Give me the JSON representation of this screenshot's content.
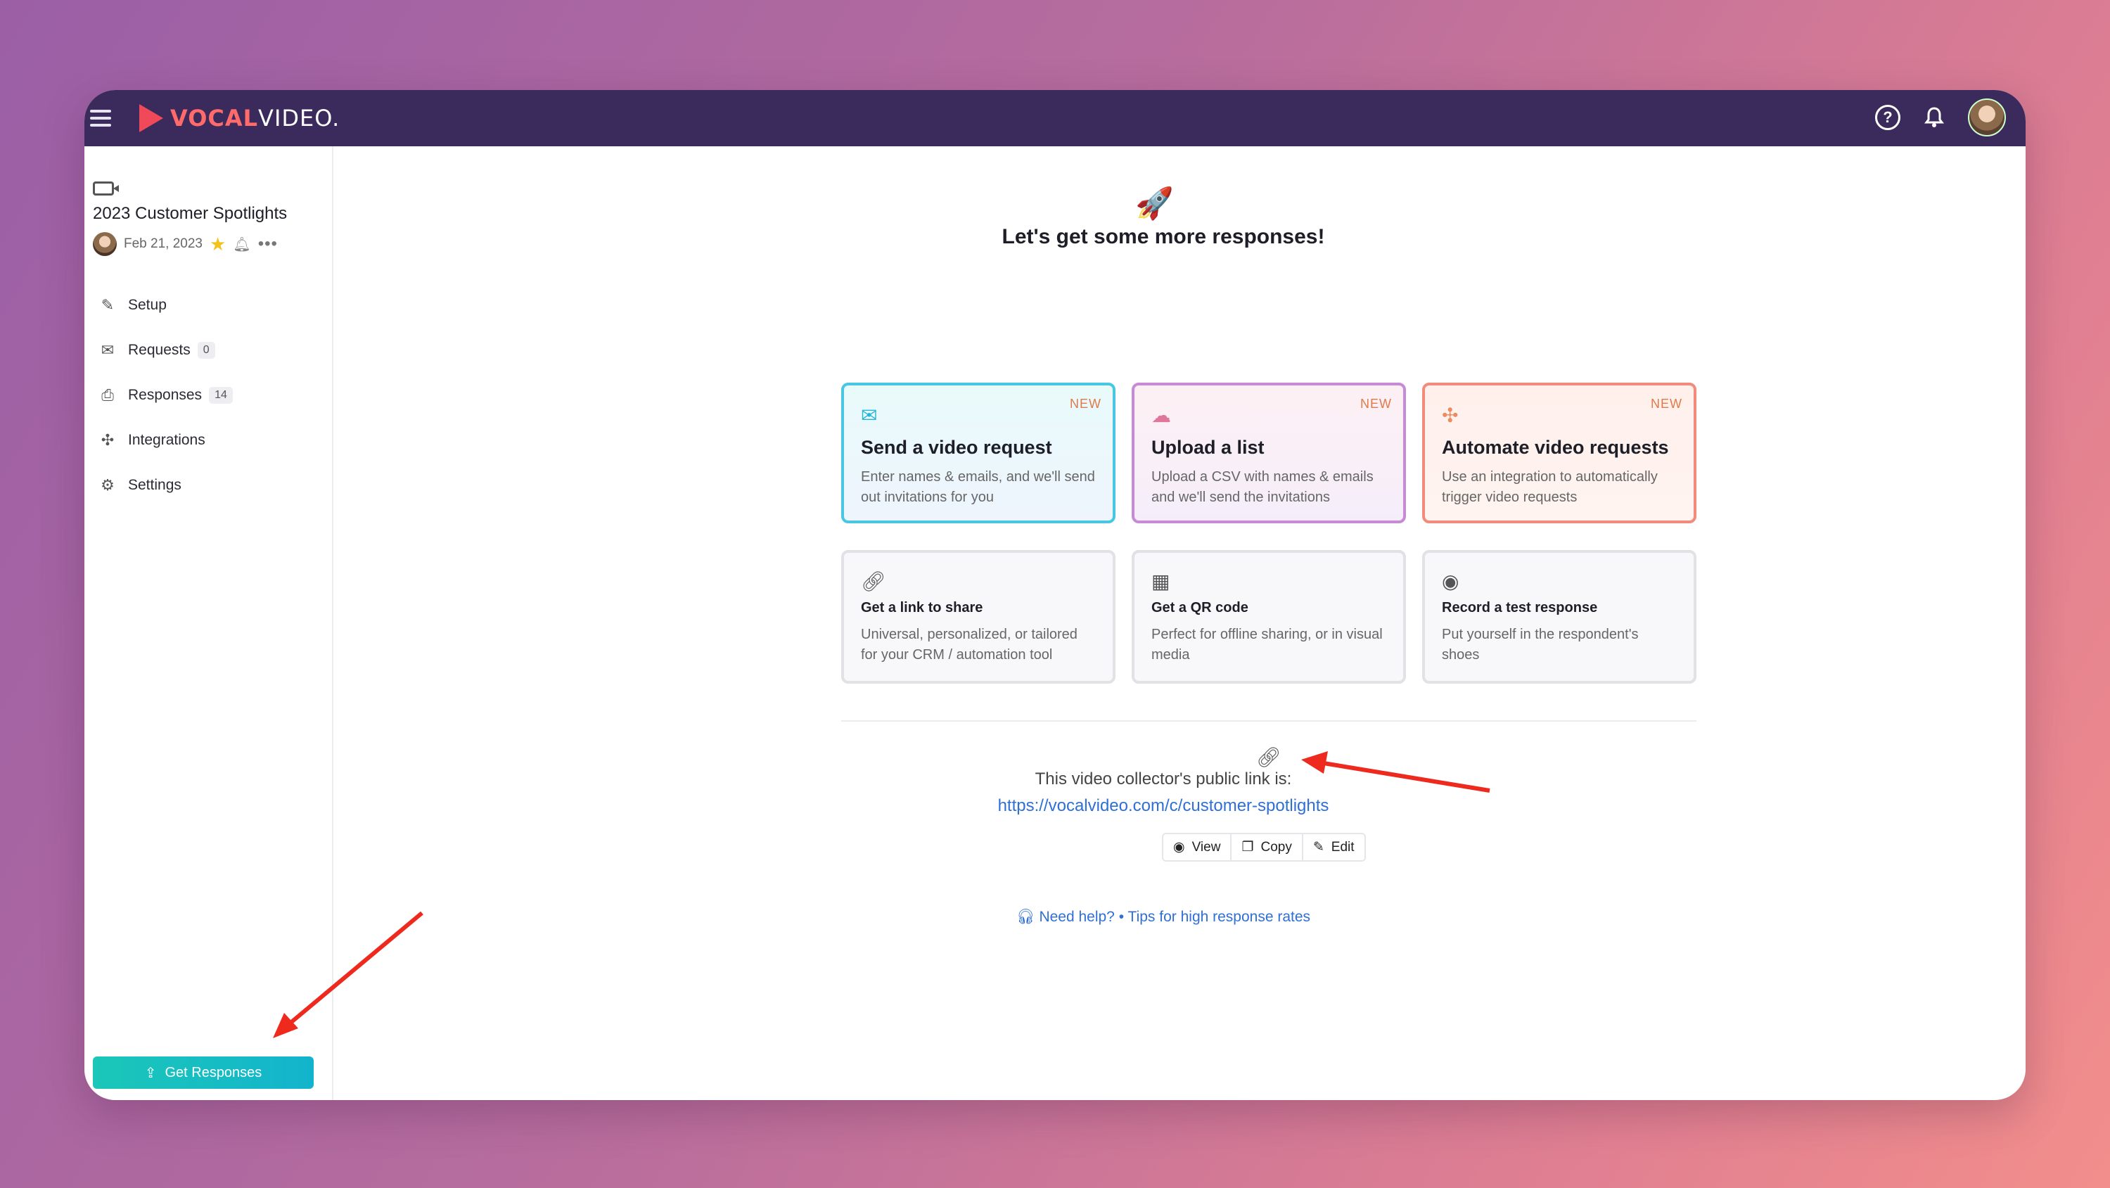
{
  "brand": {
    "logo_text_a": "VOCAL",
    "logo_text_b": "VIDEO."
  },
  "topbar": {
    "help_icon": "help-circle-icon",
    "bell_icon": "bell-icon"
  },
  "sidebar": {
    "project_title": "2023 Customer Spotlights",
    "date": "Feb 21, 2023",
    "items": [
      {
        "label": "Setup",
        "icon": "pencil-icon"
      },
      {
        "label": "Requests",
        "badge": "0",
        "icon": "mail-icon"
      },
      {
        "label": "Responses",
        "badge": "14",
        "icon": "inbox-icon"
      },
      {
        "label": "Integrations",
        "icon": "puzzle-icon"
      },
      {
        "label": "Settings",
        "icon": "gear-icon"
      }
    ],
    "cta": "Get Responses"
  },
  "main": {
    "headline": "Let's get some more responses!",
    "cards": [
      {
        "title": "Send a video request",
        "desc": "Enter names & emails, and we'll send out invitations for you",
        "tag": "NEW"
      },
      {
        "title": "Upload a list",
        "desc": "Upload a CSV with names & emails and we'll send the invitations",
        "tag": "NEW"
      },
      {
        "title": "Automate video requests",
        "desc": "Use an integration to automatically trigger video requests",
        "tag": "NEW"
      },
      {
        "title": "Get a link to share",
        "desc": "Universal, personalized, or tailored for your CRM / automation tool"
      },
      {
        "title": "Get a QR code",
        "desc": "Perfect for offline sharing, or in visual media"
      },
      {
        "title": "Record a test response",
        "desc": "Put yourself in the respondent's shoes"
      }
    ],
    "public_link_label": "This video collector's public link is:",
    "public_link_url": "https://vocalvideo.com/c/customer-spotlights",
    "actions": {
      "view": "View",
      "copy": "Copy",
      "edit": "Edit"
    },
    "help": {
      "need_help": "Need help?",
      "separator": "•",
      "tips": "Tips for high response rates"
    }
  },
  "colors": {
    "accent": "#12b4cc",
    "topbar": "#3b2a5c",
    "arrow": "#ee2a1e",
    "link": "#2f6fd6"
  }
}
